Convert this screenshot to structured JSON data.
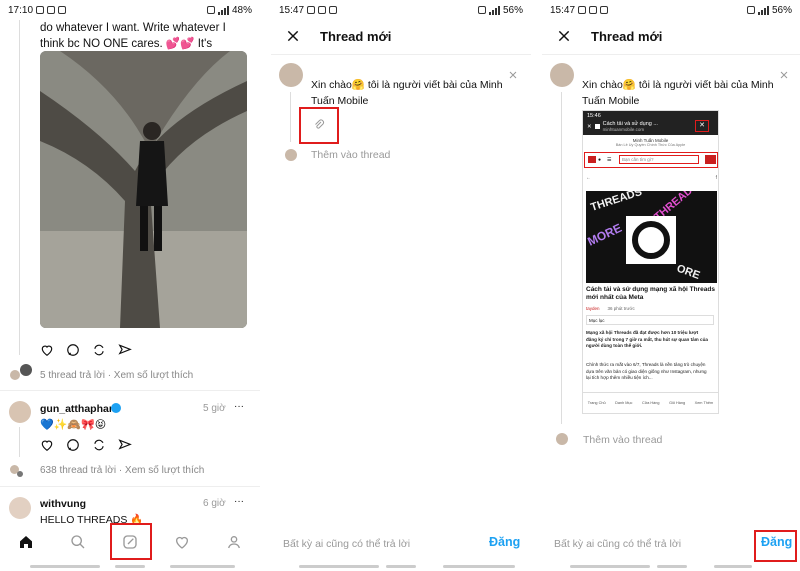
{
  "panel1": {
    "status": {
      "time": "17:10",
      "battery": "48%"
    },
    "post_text": "do whatever I want. Write whatever I think bc NO ONE cares. 💕💕 It's crazyyy",
    "post_meta": "5 thread trả lời · Xem số lượt thích",
    "reply1": {
      "username": "gun_atthaphan",
      "verified": true,
      "time": "5 giờ",
      "text": "💙✨🙈🎀😝",
      "meta": "638 thread trả lời · Xem số lượt thích"
    },
    "reply2": {
      "username": "withvung",
      "time": "6 giờ",
      "text": "HELLO THREADS 🔥"
    },
    "nav_icons": [
      "home-icon",
      "search-icon",
      "compose-icon",
      "heart-icon",
      "profile-icon"
    ]
  },
  "panel2": {
    "status": {
      "time": "15:47",
      "battery": "56%"
    },
    "title": "Thread mới",
    "post_text": "Xin chào🤗 tôi là người viết bài của Minh Tuấn Mobile",
    "add_thread": "Thêm vào thread",
    "reply_setting": "Bất kỳ ai cũng có thể trả lời",
    "post_button": "Đăng"
  },
  "panel3": {
    "status": {
      "time": "15:47",
      "battery": "56%"
    },
    "title": "Thread mới",
    "post_text": "Xin chào🤗 tôi là người viết bài của Minh Tuấn Mobile",
    "add_thread": "Thêm vào thread",
    "reply_setting": "Bất kỳ ai cũng có thể trả lời",
    "post_button": "Đăng",
    "attached": {
      "status_time": "15:46",
      "page_title": "Cách tải và sử dụng ...",
      "page_url": "minhtuanmobile.com",
      "site_name": "Minh Tuấn Mobile",
      "site_tagline": "Bán Lẻ Uy Quyền Chính Thức Của Apple",
      "search_placeholder": "Bạn cần tìm gì?",
      "headline": "Cách tải và sử dụng mạng xã hội Threads mới nhất của Meta",
      "author": "tayden",
      "posted": "36 phút trước",
      "toc": "Mục lục",
      "para1": "Mạng xã hội Threads đã đạt được hơn 10 triệu lượt đăng ký chỉ trong 7 giờ ra mắt, thu hút sự quan tâm của người dùng toàn thế giới.",
      "para2": "Chính thức ra mắt vào 6/7, Threads là nền tảng trò chuyện dựa trên văn bản có giao diện giống như Instagram, nhưng lại tích hợp thêm nhiều tiện ích...",
      "hero_words": [
        "THREADS",
        "THREADS",
        "MORE",
        "ORE"
      ],
      "bottom_tabs": [
        "Trang Chủ",
        "Danh Mục",
        "Cửa Hàng",
        "Giỏ Hàng",
        "Xem Thêm"
      ]
    }
  },
  "colors": {
    "accent": "#1da1f2",
    "highlight": "#e01c1c",
    "text": "#111111",
    "muted": "#999999"
  }
}
